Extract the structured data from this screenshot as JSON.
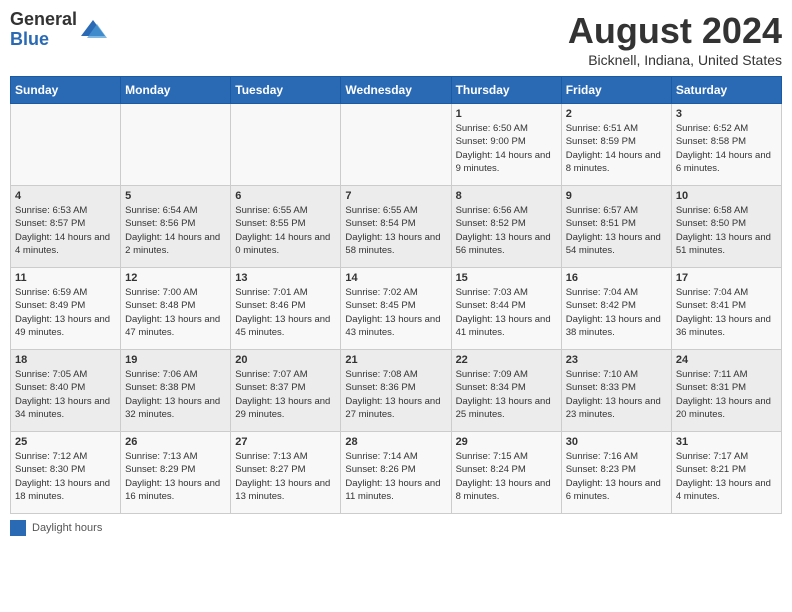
{
  "header": {
    "logo_line1": "General",
    "logo_line2": "Blue",
    "month_title": "August 2024",
    "location": "Bicknell, Indiana, United States"
  },
  "days_of_week": [
    "Sunday",
    "Monday",
    "Tuesday",
    "Wednesday",
    "Thursday",
    "Friday",
    "Saturday"
  ],
  "weeks": [
    [
      {
        "num": "",
        "info": ""
      },
      {
        "num": "",
        "info": ""
      },
      {
        "num": "",
        "info": ""
      },
      {
        "num": "",
        "info": ""
      },
      {
        "num": "1",
        "info": "Sunrise: 6:50 AM\nSunset: 9:00 PM\nDaylight: 14 hours and 9 minutes."
      },
      {
        "num": "2",
        "info": "Sunrise: 6:51 AM\nSunset: 8:59 PM\nDaylight: 14 hours and 8 minutes."
      },
      {
        "num": "3",
        "info": "Sunrise: 6:52 AM\nSunset: 8:58 PM\nDaylight: 14 hours and 6 minutes."
      }
    ],
    [
      {
        "num": "4",
        "info": "Sunrise: 6:53 AM\nSunset: 8:57 PM\nDaylight: 14 hours and 4 minutes."
      },
      {
        "num": "5",
        "info": "Sunrise: 6:54 AM\nSunset: 8:56 PM\nDaylight: 14 hours and 2 minutes."
      },
      {
        "num": "6",
        "info": "Sunrise: 6:55 AM\nSunset: 8:55 PM\nDaylight: 14 hours and 0 minutes."
      },
      {
        "num": "7",
        "info": "Sunrise: 6:55 AM\nSunset: 8:54 PM\nDaylight: 13 hours and 58 minutes."
      },
      {
        "num": "8",
        "info": "Sunrise: 6:56 AM\nSunset: 8:52 PM\nDaylight: 13 hours and 56 minutes."
      },
      {
        "num": "9",
        "info": "Sunrise: 6:57 AM\nSunset: 8:51 PM\nDaylight: 13 hours and 54 minutes."
      },
      {
        "num": "10",
        "info": "Sunrise: 6:58 AM\nSunset: 8:50 PM\nDaylight: 13 hours and 51 minutes."
      }
    ],
    [
      {
        "num": "11",
        "info": "Sunrise: 6:59 AM\nSunset: 8:49 PM\nDaylight: 13 hours and 49 minutes."
      },
      {
        "num": "12",
        "info": "Sunrise: 7:00 AM\nSunset: 8:48 PM\nDaylight: 13 hours and 47 minutes."
      },
      {
        "num": "13",
        "info": "Sunrise: 7:01 AM\nSunset: 8:46 PM\nDaylight: 13 hours and 45 minutes."
      },
      {
        "num": "14",
        "info": "Sunrise: 7:02 AM\nSunset: 8:45 PM\nDaylight: 13 hours and 43 minutes."
      },
      {
        "num": "15",
        "info": "Sunrise: 7:03 AM\nSunset: 8:44 PM\nDaylight: 13 hours and 41 minutes."
      },
      {
        "num": "16",
        "info": "Sunrise: 7:04 AM\nSunset: 8:42 PM\nDaylight: 13 hours and 38 minutes."
      },
      {
        "num": "17",
        "info": "Sunrise: 7:04 AM\nSunset: 8:41 PM\nDaylight: 13 hours and 36 minutes."
      }
    ],
    [
      {
        "num": "18",
        "info": "Sunrise: 7:05 AM\nSunset: 8:40 PM\nDaylight: 13 hours and 34 minutes."
      },
      {
        "num": "19",
        "info": "Sunrise: 7:06 AM\nSunset: 8:38 PM\nDaylight: 13 hours and 32 minutes."
      },
      {
        "num": "20",
        "info": "Sunrise: 7:07 AM\nSunset: 8:37 PM\nDaylight: 13 hours and 29 minutes."
      },
      {
        "num": "21",
        "info": "Sunrise: 7:08 AM\nSunset: 8:36 PM\nDaylight: 13 hours and 27 minutes."
      },
      {
        "num": "22",
        "info": "Sunrise: 7:09 AM\nSunset: 8:34 PM\nDaylight: 13 hours and 25 minutes."
      },
      {
        "num": "23",
        "info": "Sunrise: 7:10 AM\nSunset: 8:33 PM\nDaylight: 13 hours and 23 minutes."
      },
      {
        "num": "24",
        "info": "Sunrise: 7:11 AM\nSunset: 8:31 PM\nDaylight: 13 hours and 20 minutes."
      }
    ],
    [
      {
        "num": "25",
        "info": "Sunrise: 7:12 AM\nSunset: 8:30 PM\nDaylight: 13 hours and 18 minutes."
      },
      {
        "num": "26",
        "info": "Sunrise: 7:13 AM\nSunset: 8:29 PM\nDaylight: 13 hours and 16 minutes."
      },
      {
        "num": "27",
        "info": "Sunrise: 7:13 AM\nSunset: 8:27 PM\nDaylight: 13 hours and 13 minutes."
      },
      {
        "num": "28",
        "info": "Sunrise: 7:14 AM\nSunset: 8:26 PM\nDaylight: 13 hours and 11 minutes."
      },
      {
        "num": "29",
        "info": "Sunrise: 7:15 AM\nSunset: 8:24 PM\nDaylight: 13 hours and 8 minutes."
      },
      {
        "num": "30",
        "info": "Sunrise: 7:16 AM\nSunset: 8:23 PM\nDaylight: 13 hours and 6 minutes."
      },
      {
        "num": "31",
        "info": "Sunrise: 7:17 AM\nSunset: 8:21 PM\nDaylight: 13 hours and 4 minutes."
      }
    ]
  ],
  "footer": {
    "legend_label": "Daylight hours"
  }
}
